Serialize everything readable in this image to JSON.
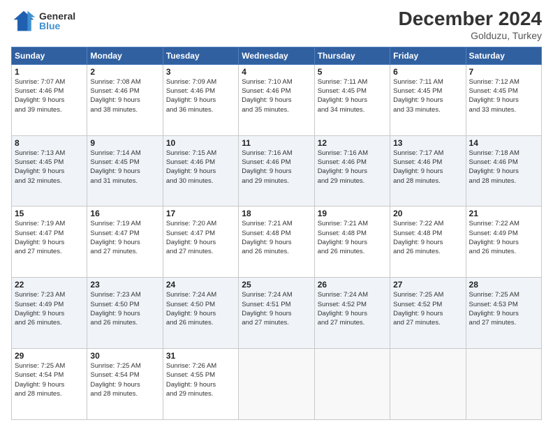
{
  "header": {
    "logo_line1": "General",
    "logo_line2": "Blue",
    "month": "December 2024",
    "location": "Golduzu, Turkey"
  },
  "weekdays": [
    "Sunday",
    "Monday",
    "Tuesday",
    "Wednesday",
    "Thursday",
    "Friday",
    "Saturday"
  ],
  "weeks": [
    [
      {
        "day": "1",
        "info": "Sunrise: 7:07 AM\nSunset: 4:46 PM\nDaylight: 9 hours\nand 39 minutes."
      },
      {
        "day": "2",
        "info": "Sunrise: 7:08 AM\nSunset: 4:46 PM\nDaylight: 9 hours\nand 38 minutes."
      },
      {
        "day": "3",
        "info": "Sunrise: 7:09 AM\nSunset: 4:46 PM\nDaylight: 9 hours\nand 36 minutes."
      },
      {
        "day": "4",
        "info": "Sunrise: 7:10 AM\nSunset: 4:46 PM\nDaylight: 9 hours\nand 35 minutes."
      },
      {
        "day": "5",
        "info": "Sunrise: 7:11 AM\nSunset: 4:45 PM\nDaylight: 9 hours\nand 34 minutes."
      },
      {
        "day": "6",
        "info": "Sunrise: 7:11 AM\nSunset: 4:45 PM\nDaylight: 9 hours\nand 33 minutes."
      },
      {
        "day": "7",
        "info": "Sunrise: 7:12 AM\nSunset: 4:45 PM\nDaylight: 9 hours\nand 33 minutes."
      }
    ],
    [
      {
        "day": "8",
        "info": "Sunrise: 7:13 AM\nSunset: 4:45 PM\nDaylight: 9 hours\nand 32 minutes."
      },
      {
        "day": "9",
        "info": "Sunrise: 7:14 AM\nSunset: 4:45 PM\nDaylight: 9 hours\nand 31 minutes."
      },
      {
        "day": "10",
        "info": "Sunrise: 7:15 AM\nSunset: 4:46 PM\nDaylight: 9 hours\nand 30 minutes."
      },
      {
        "day": "11",
        "info": "Sunrise: 7:16 AM\nSunset: 4:46 PM\nDaylight: 9 hours\nand 29 minutes."
      },
      {
        "day": "12",
        "info": "Sunrise: 7:16 AM\nSunset: 4:46 PM\nDaylight: 9 hours\nand 29 minutes."
      },
      {
        "day": "13",
        "info": "Sunrise: 7:17 AM\nSunset: 4:46 PM\nDaylight: 9 hours\nand 28 minutes."
      },
      {
        "day": "14",
        "info": "Sunrise: 7:18 AM\nSunset: 4:46 PM\nDaylight: 9 hours\nand 28 minutes."
      }
    ],
    [
      {
        "day": "15",
        "info": "Sunrise: 7:19 AM\nSunset: 4:47 PM\nDaylight: 9 hours\nand 27 minutes."
      },
      {
        "day": "16",
        "info": "Sunrise: 7:19 AM\nSunset: 4:47 PM\nDaylight: 9 hours\nand 27 minutes."
      },
      {
        "day": "17",
        "info": "Sunrise: 7:20 AM\nSunset: 4:47 PM\nDaylight: 9 hours\nand 27 minutes."
      },
      {
        "day": "18",
        "info": "Sunrise: 7:21 AM\nSunset: 4:48 PM\nDaylight: 9 hours\nand 26 minutes."
      },
      {
        "day": "19",
        "info": "Sunrise: 7:21 AM\nSunset: 4:48 PM\nDaylight: 9 hours\nand 26 minutes."
      },
      {
        "day": "20",
        "info": "Sunrise: 7:22 AM\nSunset: 4:48 PM\nDaylight: 9 hours\nand 26 minutes."
      },
      {
        "day": "21",
        "info": "Sunrise: 7:22 AM\nSunset: 4:49 PM\nDaylight: 9 hours\nand 26 minutes."
      }
    ],
    [
      {
        "day": "22",
        "info": "Sunrise: 7:23 AM\nSunset: 4:49 PM\nDaylight: 9 hours\nand 26 minutes."
      },
      {
        "day": "23",
        "info": "Sunrise: 7:23 AM\nSunset: 4:50 PM\nDaylight: 9 hours\nand 26 minutes."
      },
      {
        "day": "24",
        "info": "Sunrise: 7:24 AM\nSunset: 4:50 PM\nDaylight: 9 hours\nand 26 minutes."
      },
      {
        "day": "25",
        "info": "Sunrise: 7:24 AM\nSunset: 4:51 PM\nDaylight: 9 hours\nand 27 minutes."
      },
      {
        "day": "26",
        "info": "Sunrise: 7:24 AM\nSunset: 4:52 PM\nDaylight: 9 hours\nand 27 minutes."
      },
      {
        "day": "27",
        "info": "Sunrise: 7:25 AM\nSunset: 4:52 PM\nDaylight: 9 hours\nand 27 minutes."
      },
      {
        "day": "28",
        "info": "Sunrise: 7:25 AM\nSunset: 4:53 PM\nDaylight: 9 hours\nand 27 minutes."
      }
    ],
    [
      {
        "day": "29",
        "info": "Sunrise: 7:25 AM\nSunset: 4:54 PM\nDaylight: 9 hours\nand 28 minutes."
      },
      {
        "day": "30",
        "info": "Sunrise: 7:25 AM\nSunset: 4:54 PM\nDaylight: 9 hours\nand 28 minutes."
      },
      {
        "day": "31",
        "info": "Sunrise: 7:26 AM\nSunset: 4:55 PM\nDaylight: 9 hours\nand 29 minutes."
      },
      null,
      null,
      null,
      null
    ]
  ]
}
